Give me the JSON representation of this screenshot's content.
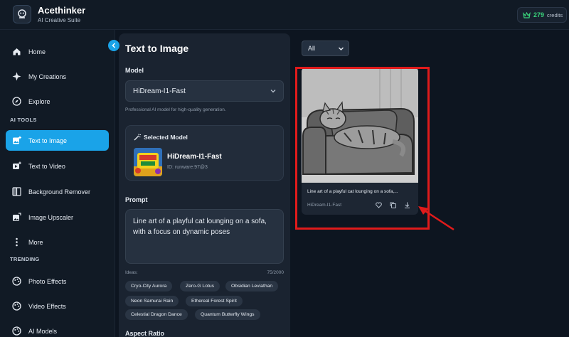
{
  "brand": {
    "name": "Acethinker",
    "subtitle": "AI Creative Suite"
  },
  "credits": {
    "amount": "279",
    "label": "credits"
  },
  "sidebar": {
    "items": [
      {
        "label": "Home",
        "icon": "home-icon"
      },
      {
        "label": "My Creations",
        "icon": "sparkle-icon"
      },
      {
        "label": "Explore",
        "icon": "compass-icon"
      }
    ],
    "section_ai_tools": "AI TOOLS",
    "tools": [
      {
        "label": "Text to Image",
        "icon": "image-plus-icon",
        "active": true
      },
      {
        "label": "Text to Video",
        "icon": "video-plus-icon"
      },
      {
        "label": "Background Remover",
        "icon": "background-remove-icon"
      },
      {
        "label": "Image Upscaler",
        "icon": "upscale-icon"
      },
      {
        "label": "More",
        "icon": "more-vertical-icon"
      }
    ],
    "section_trending": "TRENDING",
    "trending": [
      {
        "label": "Photo Effects",
        "icon": "palette-icon"
      },
      {
        "label": "Video Effects",
        "icon": "palette-icon"
      },
      {
        "label": "AI Models",
        "icon": "palette-icon"
      }
    ]
  },
  "panel": {
    "title": "Text to Image",
    "model_label": "Model",
    "model_value": "HiDream-I1-Fast",
    "model_hint": "Professional AI model for high-quality generation.",
    "selected_heading": "Selected Model",
    "selected_name": "HiDream-I1-Fast",
    "selected_id": "ID: runware:97@3",
    "prompt_label": "Prompt",
    "prompt_text": "Line art of a playful cat lounging on a sofa, with a focus on dynamic poses",
    "ideas_label": "Ideas:",
    "char_count": "75/2000",
    "ideas": [
      "Cryo-City Aurora",
      "Zero-G Lotus",
      "Obsidian Leviathan",
      "Neon Samurai Rain",
      "Ethereal Forest Spirit",
      "Celestial Dragon Dance",
      "Quantum Butterfly Wings"
    ],
    "aspect_label": "Aspect Ratio"
  },
  "main": {
    "filter_value": "All",
    "results": [
      {
        "caption": "Line art of a playful cat lounging on a sofa,...",
        "model": "HiDream-I1-Fast"
      }
    ]
  },
  "colors": {
    "accent": "#1aa3e8",
    "highlight": "#e01b1b",
    "credits": "#39d17a"
  }
}
